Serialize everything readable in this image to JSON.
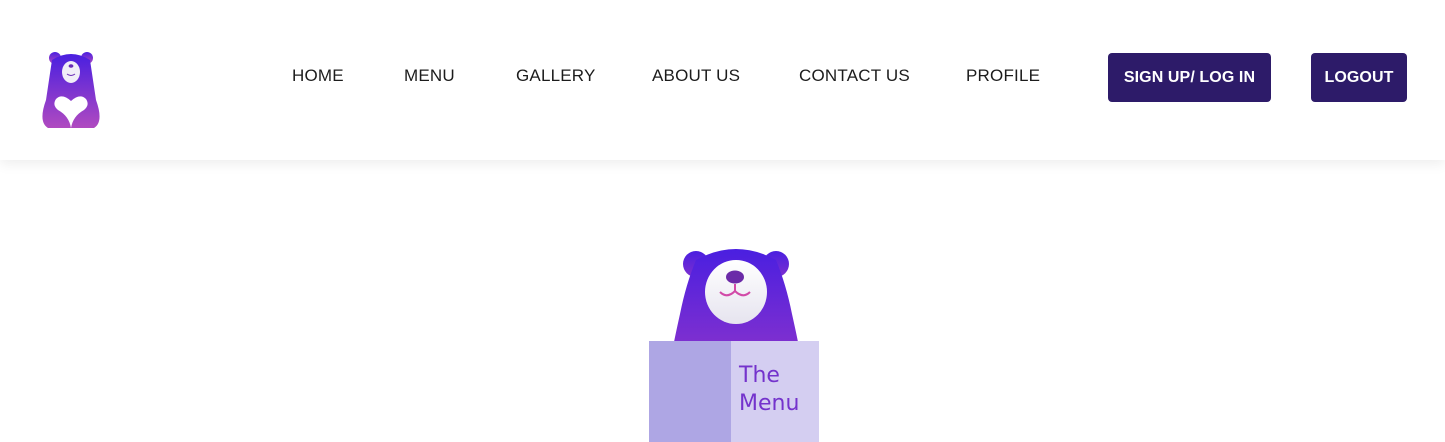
{
  "nav": {
    "items": [
      {
        "label": "HOME"
      },
      {
        "label": "MENU"
      },
      {
        "label": "GALLERY"
      },
      {
        "label": "ABOUT US"
      },
      {
        "label": "CONTACT US"
      },
      {
        "label": "PROFILE"
      }
    ],
    "signup_label": "SIGN UP/ LOG IN",
    "logout_label": "LOGOUT"
  },
  "hero": {
    "menu_title": "The Menu"
  },
  "colors": {
    "button_bg": "#2d1b69",
    "bear_top": "#4a1fe0",
    "bear_bottom": "#b04ac0",
    "menu_left": "#aea6e4",
    "menu_right": "#d4cef1",
    "menu_text": "#7433cc"
  },
  "icons": [
    "bear-heart-logo-icon",
    "bear-mascot-icon"
  ]
}
